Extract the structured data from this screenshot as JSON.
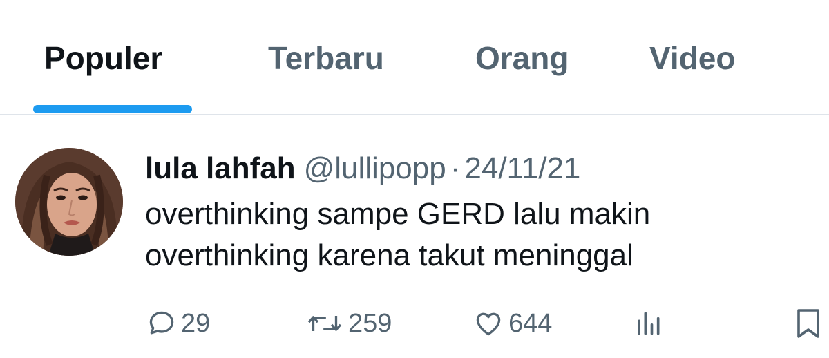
{
  "tabs": [
    {
      "label": "Populer",
      "active": true
    },
    {
      "label": "Terbaru",
      "active": false
    },
    {
      "label": "Orang",
      "active": false
    },
    {
      "label": "Video",
      "active": false
    }
  ],
  "accent_color": "#1d9bf0",
  "tweet": {
    "display_name": "lula lahfah",
    "handle": "@lullipopp",
    "separator": "·",
    "date": "24/11/21",
    "text_lines": [
      "overthinking sampe GERD lalu makin",
      "overthinking karena takut meninggal"
    ],
    "stats": {
      "replies": "29",
      "retweets": "259",
      "likes": "644"
    }
  },
  "icons": {
    "reply": "speech-bubble-icon",
    "retweet": "retweet-arrows-icon",
    "like": "heart-icon",
    "views": "bar-chart-icon",
    "bookmark": "bookmark-icon"
  }
}
